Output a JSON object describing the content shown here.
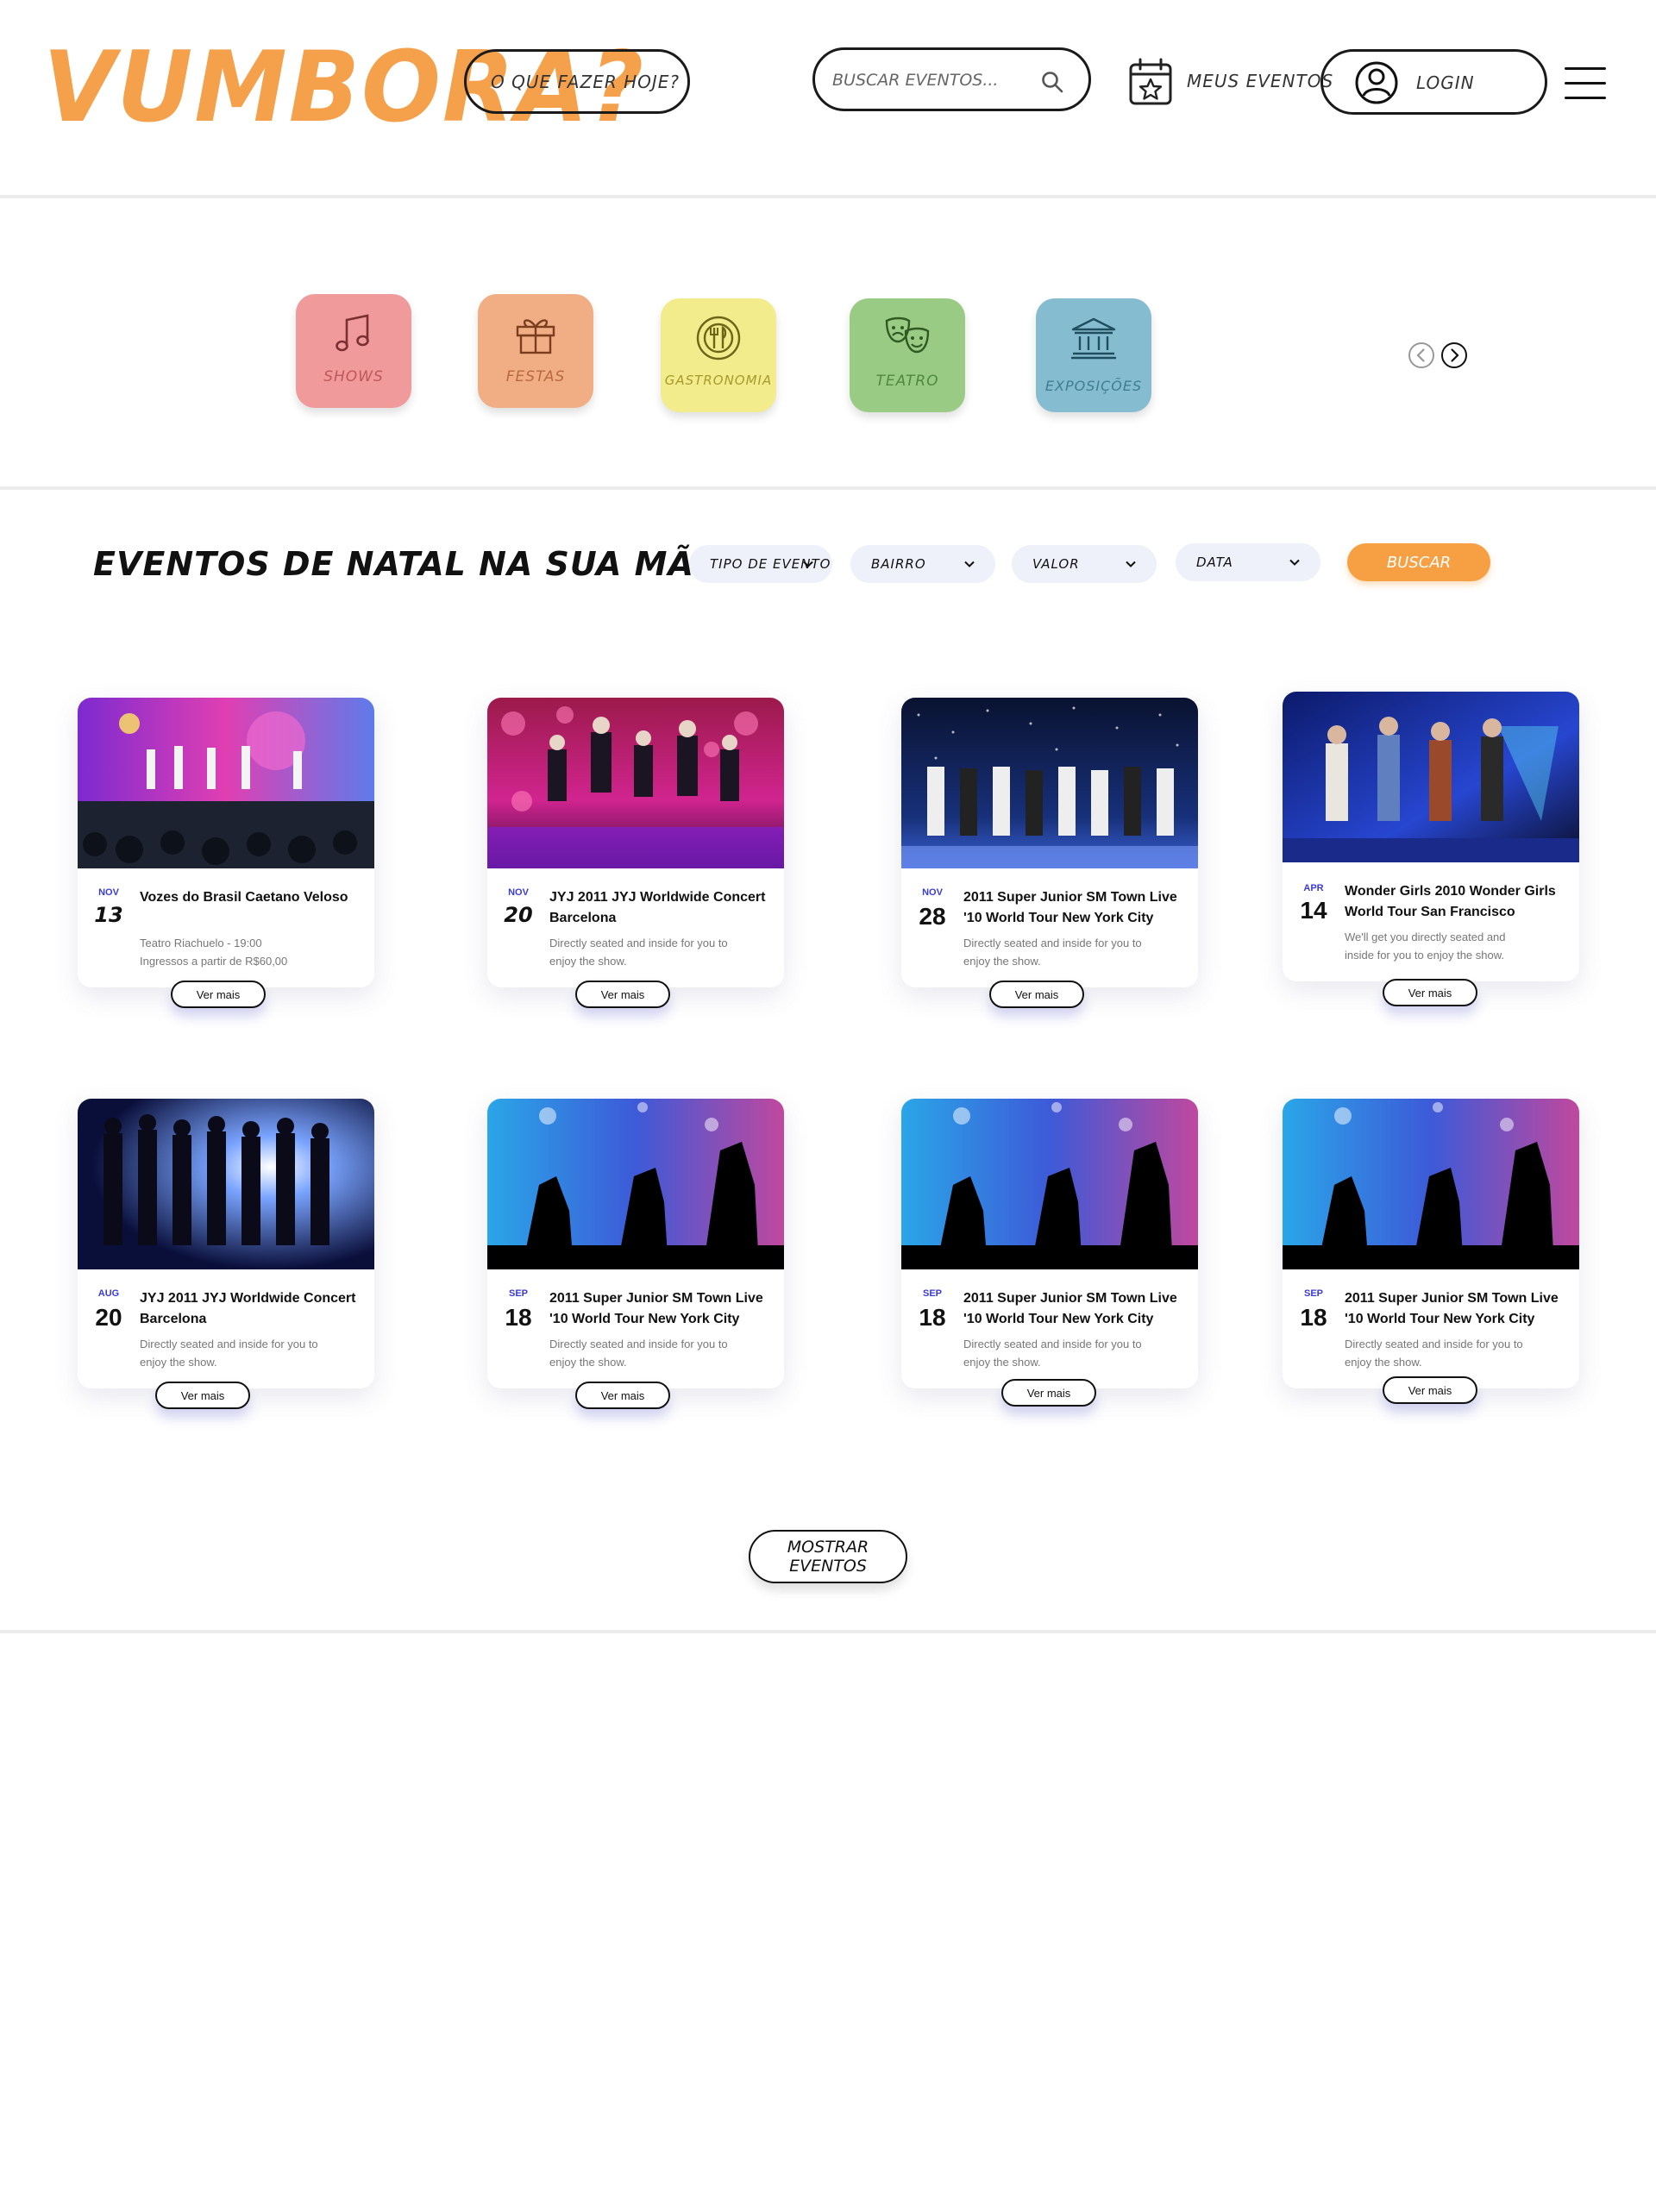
{
  "brand": {
    "logo": "VUMBORA?"
  },
  "header": {
    "what_todo": "O QUE FAZER HOJE?",
    "search_placeholder": "BUSCAR EVENTOS...",
    "my_events": "MEUS EVENTOS",
    "login": "LOGIN"
  },
  "categories": [
    {
      "label": "SHOWS",
      "icon": "music-icon",
      "color": "#f09a9c",
      "text_color": "#c0585a"
    },
    {
      "label": "FESTAS",
      "icon": "gift-icon",
      "color": "#f1ae85",
      "text_color": "#b86a3c"
    },
    {
      "label": "GASTRONOMIA",
      "icon": "dining-icon",
      "color": "#f2ec8d",
      "text_color": "#a89a2c"
    },
    {
      "label": "TEATRO",
      "icon": "theater-masks-icon",
      "color": "#9acb85",
      "text_color": "#4d8a3c"
    },
    {
      "label": "EXPOSIÇÕES",
      "icon": "museum-icon",
      "color": "#86bccf",
      "text_color": "#3d7d93"
    }
  ],
  "section": {
    "title": "EVENTOS DE NATAL NA SUA MÃO",
    "filters": [
      "TIPO DE EVENTO",
      "BAIRRO",
      "VALOR",
      "DATA"
    ],
    "search_button": "BUSCAR"
  },
  "events": [
    {
      "month": "NOV",
      "day": "13",
      "title": "Vozes do Brasil Caetano Veloso",
      "desc_lines": [
        "Teatro Riachuelo - 19:00",
        "Ingressos a partir de R$60,00"
      ],
      "button": "Ver mais",
      "image": "concert-stage-colorful"
    },
    {
      "month": "NOV",
      "day": "20",
      "title": "JYJ 2011 JYJ Worldwide Concert Barcelona",
      "desc_lines": [
        "Directly seated and inside for you to",
        "enjoy the show."
      ],
      "button": "Ver mais",
      "image": "concert-jump-pink"
    },
    {
      "month": "NOV",
      "day": "28",
      "title": "2011 Super Junior SM Town Live '10 World Tour New York City",
      "desc_lines": [
        "Directly seated and inside for you to",
        "enjoy the show."
      ],
      "button": "Ver mais",
      "image": "concert-bow-blue"
    },
    {
      "month": "APR",
      "day": "14",
      "title": "Wonder Girls 2010 Wonder Girls World Tour San Francisco",
      "desc_lines": [
        "We'll get you directly seated and",
        "inside for you to enjoy the show."
      ],
      "button": "Ver mais",
      "image": "concert-dance-blue"
    },
    {
      "month": "AUG",
      "day": "20",
      "title": "JYJ 2011 JYJ Worldwide Concert Barcelona",
      "desc_lines": [
        "Directly seated and inside for you to",
        "enjoy the show."
      ],
      "button": "Ver mais",
      "image": "concert-silhouette-spotlight"
    },
    {
      "month": "SEP",
      "day": "18",
      "title": "2011 Super Junior SM Town Live '10 World Tour New York City",
      "desc_lines": [
        "Directly seated and inside for you to",
        "enjoy the show."
      ],
      "button": "Ver mais",
      "image": "crowd-finger-hearts"
    },
    {
      "month": "SEP",
      "day": "18",
      "title": "2011 Super Junior SM Town Live '10 World Tour New York City",
      "desc_lines": [
        "Directly seated and inside for you to",
        "enjoy the show."
      ],
      "button": "Ver mais",
      "image": "crowd-finger-hearts"
    },
    {
      "month": "SEP",
      "day": "18",
      "title": "2011 Super Junior SM Town Live '10 World Tour New York City",
      "desc_lines": [
        "Directly seated and inside for you to",
        "enjoy the show."
      ],
      "button": "Ver mais",
      "image": "crowd-finger-hearts"
    }
  ],
  "show_more": "MOSTRAR EVENTOS"
}
